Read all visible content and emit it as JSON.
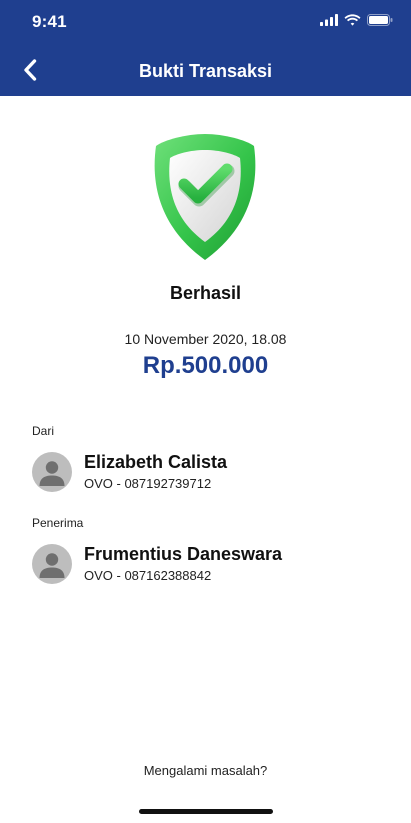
{
  "status_bar": {
    "time": "9:41"
  },
  "nav": {
    "title": "Bukti Transaksi",
    "back_icon": "chevron-left-icon"
  },
  "transaction": {
    "status": "Berhasil",
    "datetime": "10 November 2020, 18.08",
    "amount": "Rp.500.000"
  },
  "sender": {
    "section_label": "Dari",
    "name": "Elizabeth Calista",
    "account": "OVO - 087192739712"
  },
  "recipient": {
    "section_label": "Penerima",
    "name": "Frumentius Daneswara",
    "account": "OVO - 087162388842"
  },
  "footer": {
    "help_text": "Mengalami masalah?"
  },
  "colors": {
    "primary": "#1f3f8f",
    "success": "#36c24a",
    "avatar_bg": "#bdbdbd"
  }
}
